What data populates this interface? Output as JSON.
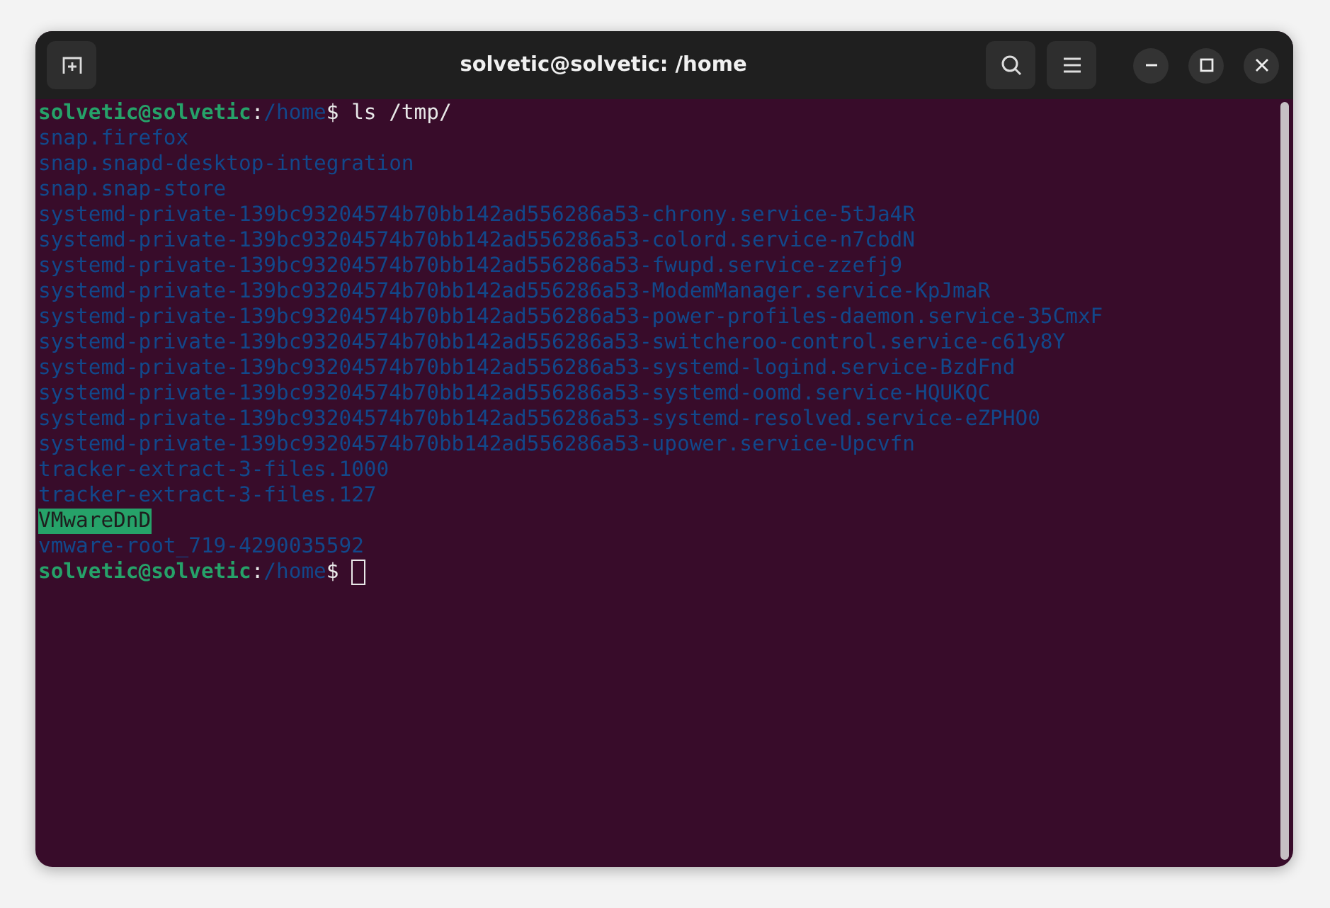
{
  "window": {
    "title": "solvetic@solvetic: /home"
  },
  "terminal": {
    "lines": [
      {
        "kind": "prompt",
        "user": "solvetic@solvetic",
        "separator": ":",
        "path": "/home",
        "symbol": "$",
        "command": "ls /tmp/",
        "cursor": false
      },
      {
        "kind": "directory",
        "text": "snap.firefox"
      },
      {
        "kind": "directory",
        "text": "snap.snapd-desktop-integration"
      },
      {
        "kind": "directory",
        "text": "snap.snap-store"
      },
      {
        "kind": "directory",
        "text": "systemd-private-139bc93204574b70bb142ad556286a53-chrony.service-5tJa4R"
      },
      {
        "kind": "directory",
        "text": "systemd-private-139bc93204574b70bb142ad556286a53-colord.service-n7cbdN"
      },
      {
        "kind": "directory",
        "text": "systemd-private-139bc93204574b70bb142ad556286a53-fwupd.service-zzefj9"
      },
      {
        "kind": "directory",
        "text": "systemd-private-139bc93204574b70bb142ad556286a53-ModemManager.service-KpJmaR"
      },
      {
        "kind": "directory",
        "text": "systemd-private-139bc93204574b70bb142ad556286a53-power-profiles-daemon.service-35CmxF"
      },
      {
        "kind": "directory",
        "text": "systemd-private-139bc93204574b70bb142ad556286a53-switcheroo-control.service-c61y8Y"
      },
      {
        "kind": "directory",
        "text": "systemd-private-139bc93204574b70bb142ad556286a53-systemd-logind.service-BzdFnd"
      },
      {
        "kind": "directory",
        "text": "systemd-private-139bc93204574b70bb142ad556286a53-systemd-oomd.service-HQUKQC"
      },
      {
        "kind": "directory",
        "text": "systemd-private-139bc93204574b70bb142ad556286a53-systemd-resolved.service-eZPHO0"
      },
      {
        "kind": "directory",
        "text": "systemd-private-139bc93204574b70bb142ad556286a53-upower.service-Upcvfn"
      },
      {
        "kind": "directory",
        "text": "tracker-extract-3-files.1000"
      },
      {
        "kind": "directory",
        "text": "tracker-extract-3-files.127"
      },
      {
        "kind": "sticky-directory",
        "text": "VMwareDnD"
      },
      {
        "kind": "directory",
        "text": "vmware-root_719-4290035592"
      },
      {
        "kind": "prompt",
        "user": "solvetic@solvetic",
        "separator": ":",
        "path": "/home",
        "symbol": "$",
        "cursor": true
      }
    ]
  }
}
